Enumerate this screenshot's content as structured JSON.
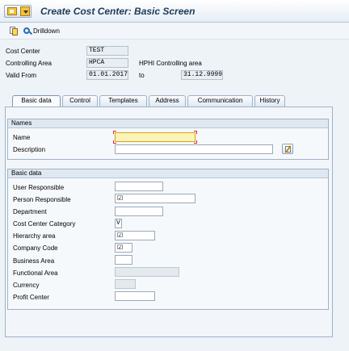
{
  "window": {
    "title": "Create Cost Center: Basic Screen"
  },
  "toolbar": {
    "drilldown_label": "Drilldown"
  },
  "header": {
    "cost_center_label": "Cost Center",
    "cost_center_value": "TEST",
    "controlling_area_label": "Controlling Area",
    "controlling_area_value": "HPCA",
    "controlling_area_text": "HPHI Controlling area",
    "valid_from_label": "Valid From",
    "valid_from_value": "01.01.2017",
    "to_label": "to",
    "valid_to_value": "31.12.9999"
  },
  "tabs": [
    "Basic data",
    "Control",
    "Templates",
    "Address",
    "Communication",
    "History"
  ],
  "names_group": {
    "title": "Names",
    "name_label": "Name",
    "name_value": "",
    "description_label": "Description",
    "description_value": ""
  },
  "basic_group": {
    "title": "Basic data",
    "user_responsible_label": "User Responsible",
    "person_responsible_label": "Person Responsible",
    "department_label": "Department",
    "category_label": "Cost Center Category",
    "category_value": "V",
    "hierarchy_label": "Hierarchy area",
    "company_code_label": "Company Code",
    "business_area_label": "Business Area",
    "functional_area_label": "Functional Area",
    "currency_label": "Currency",
    "profit_center_label": "Profit Center",
    "check_glyph": "☑"
  },
  "colors": {
    "title": "#1f3b5a",
    "required_field": "#fbf4b8",
    "panel": "#f2f6fa"
  }
}
